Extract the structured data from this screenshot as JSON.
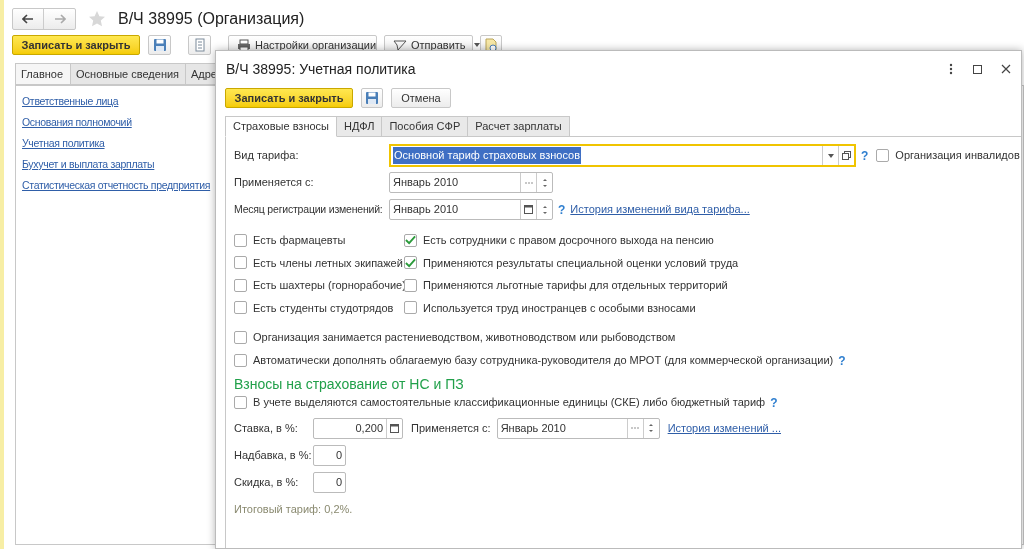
{
  "main_window": {
    "title": "В/Ч 38995 (Организация)",
    "toolbar": {
      "save_close": "Записать и закрыть",
      "settings": "Настройки организации",
      "send": "Отправить"
    },
    "tabs": [
      {
        "label": "Главное",
        "selected": true
      },
      {
        "label": "Основные сведения",
        "selected": false
      },
      {
        "label": "Адре",
        "selected": false
      }
    ],
    "links": [
      "Ответственные лица",
      "Основания полномочий",
      "Учетная политика",
      "Бухучет и выплата зарплаты",
      "Статистическая отчетность предприятия"
    ]
  },
  "dialog": {
    "title": "В/Ч 38995: Учетная политика",
    "buttons": {
      "save_close": "Записать и закрыть",
      "cancel": "Отмена"
    },
    "tabs": [
      {
        "label": "Страховые взносы",
        "selected": true
      },
      {
        "label": "НДФЛ",
        "selected": false
      },
      {
        "label": "Пособия СФР",
        "selected": false
      },
      {
        "label": "Расчет зарплаты",
        "selected": false
      }
    ],
    "tariff": {
      "label": "Вид тарифа:",
      "value": "Основной тариф страховых взносов",
      "help": "?",
      "disabled_org": {
        "label": "Организация инвалидов",
        "checked": false
      }
    },
    "applies_from": {
      "label": "Применяется с:",
      "value": "Январь 2010"
    },
    "registration_month": {
      "label": "Месяц регистрации изменений:",
      "value": "Январь 2010",
      "help": "?",
      "link": "История изменений вида тарифа..."
    },
    "checkbox_columns": [
      [
        {
          "label": "Есть фармацевты",
          "checked": false
        },
        {
          "label": "Есть члены летных экипажей",
          "checked": false
        },
        {
          "label": "Есть шахтеры (горнорабочие)",
          "checked": false
        },
        {
          "label": "Есть студенты студотрядов",
          "checked": false
        }
      ],
      [
        {
          "label": "Есть сотрудники с правом досрочного выхода на пенсию",
          "checked": true
        },
        {
          "label": "Применяются результаты специальной оценки условий труда",
          "checked": true
        },
        {
          "label": "Применяются льготные тарифы для отдельных территорий",
          "checked": false
        },
        {
          "label": "Используется труд иностранцев с особыми взносами",
          "checked": false
        }
      ]
    ],
    "wide_checkboxes": [
      {
        "label": "Организация занимается растениеводством, животноводством или рыбоводством",
        "checked": false
      },
      {
        "label": "Автоматически дополнять облагаемую базу сотрудника-руководителя до МРОТ (для коммерческой организации)",
        "checked": false,
        "help": "?"
      }
    ],
    "section": {
      "heading": "Взносы на страхование от НС и ПЗ",
      "ske": {
        "label": "В учете выделяются самостоятельные классификационные единицы (СКЕ) либо бюджетный тариф",
        "checked": false,
        "help": "?"
      },
      "rate": {
        "label": "Ставка, в %:",
        "value": "0,200",
        "applies_label": "Применяется с:",
        "applies_value": "Январь 2010",
        "link": "История изменений ..."
      },
      "surcharge": {
        "label": "Надбавка, в %:",
        "value": "0"
      },
      "discount": {
        "label": "Скидка, в %:",
        "value": "0"
      },
      "total": "Итоговый тариф: 0,2%."
    }
  }
}
